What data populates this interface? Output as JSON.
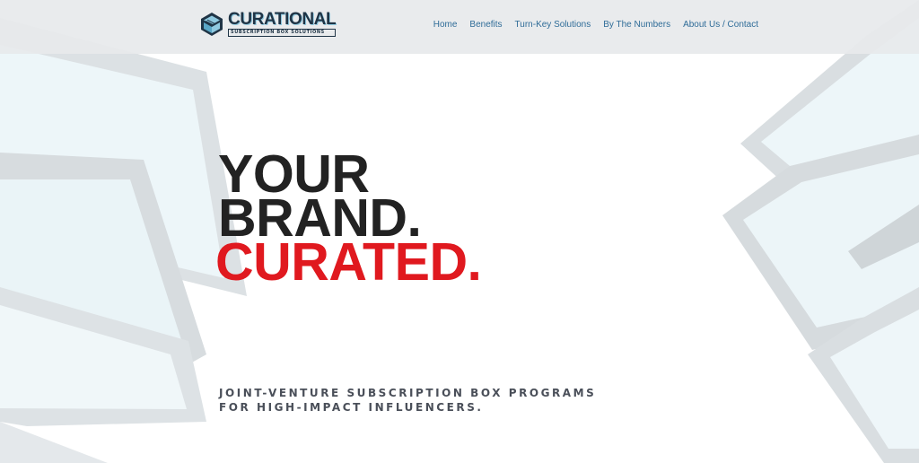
{
  "brand": {
    "logo_name": "CURATIONAL",
    "logo_tagline": "SUBSCRIPTION BOX SOLUTIONS",
    "logo_icon": "stacked-box-icon"
  },
  "nav": {
    "items": [
      {
        "label": "Home"
      },
      {
        "label": "Benefits"
      },
      {
        "label": "Turn-Key Solutions"
      },
      {
        "label": "By The Numbers"
      },
      {
        "label": "About Us / Contact"
      }
    ]
  },
  "hero": {
    "line1": "YOUR",
    "line2": "BRAND.",
    "line3": "CURATED."
  },
  "tagline": {
    "line1": "JOINT-VENTURE SUBSCRIPTION BOX PROGRAMS",
    "line2": "FOR HIGH-IMPACT INFLUENCERS."
  },
  "colors": {
    "header_bg": "#e7eaec",
    "nav_link": "#2f6c98",
    "headline_dark": "#222222",
    "headline_accent": "#e0191f",
    "tagline": "#4a4f59",
    "background_art": "#dfe3e6"
  }
}
